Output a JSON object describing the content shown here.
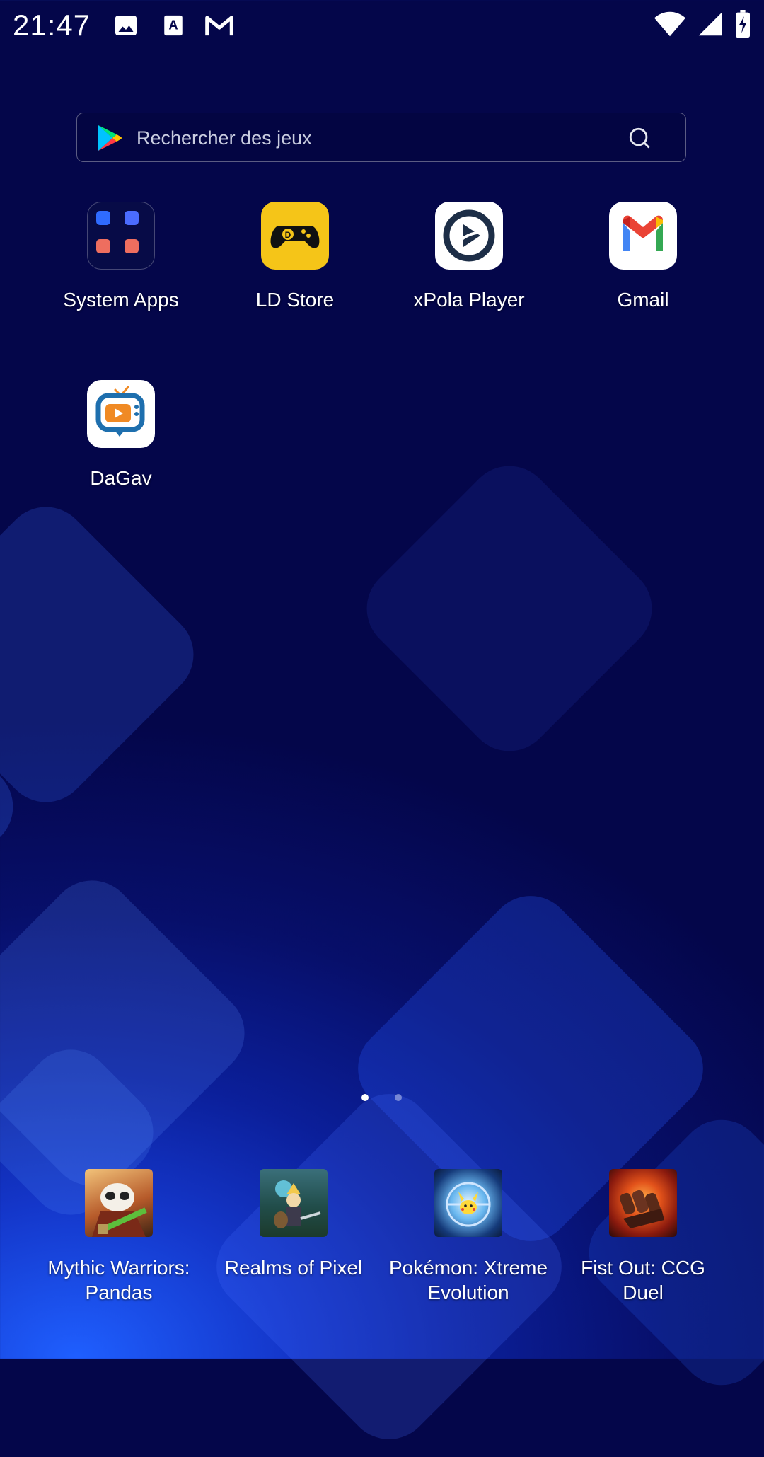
{
  "status_bar": {
    "time": "21:47",
    "notifications": [
      "image-icon",
      "text-a-icon",
      "gmail-icon"
    ],
    "indicators": [
      "wifi-icon",
      "signal-icon",
      "battery-charging-icon"
    ]
  },
  "search": {
    "placeholder": "Rechercher des jeux",
    "left_icon": "google-play-icon",
    "right_icon": "search-icon"
  },
  "apps": [
    {
      "label": "System Apps",
      "icon": "system-apps-folder-icon"
    },
    {
      "label": "LD Store",
      "icon": "ld-store-icon"
    },
    {
      "label": "xPola Player",
      "icon": "xpola-player-icon"
    },
    {
      "label": "Gmail",
      "icon": "gmail-app-icon"
    },
    {
      "label": "DaGav",
      "icon": "dagav-icon"
    }
  ],
  "pager": {
    "pages": 2,
    "active": 1
  },
  "dock": [
    {
      "label": "Mythic Warriors: Pandas",
      "icon": "mythic-warriors-icon"
    },
    {
      "label": "Realms of Pixel",
      "icon": "realms-of-pixel-icon"
    },
    {
      "label": "Pokémon: Xtreme Evolution",
      "icon": "pokemon-xtreme-icon"
    },
    {
      "label": "Fist Out: CCG Duel",
      "icon": "fist-out-icon"
    }
  ],
  "colors": {
    "accent_yellow": "#F5C518",
    "background_dark": "#04064a",
    "background_light": "#1f5fff"
  }
}
